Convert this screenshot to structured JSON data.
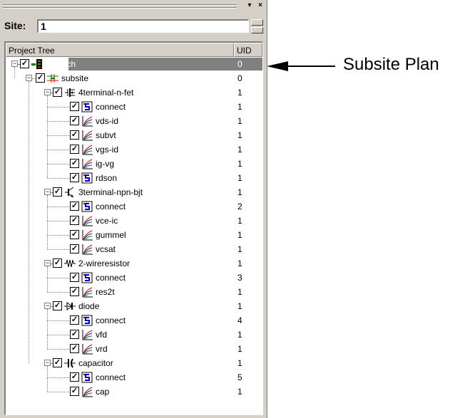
{
  "window": {
    "minimize_glyph": "▾",
    "close_glyph": "×"
  },
  "site": {
    "label": "Site:",
    "value": "1"
  },
  "tree": {
    "col_project": "Project Tree",
    "col_uid": "UID",
    "rows": [
      {
        "label": "ivswitch",
        "uid": "0",
        "icon": "plan-icon",
        "level": 0,
        "expander": "minus",
        "selected": true
      },
      {
        "label": "subsite",
        "uid": "0",
        "icon": "subsite-icon",
        "level": 1,
        "expander": "minus"
      },
      {
        "label": "4terminal-n-fet",
        "uid": "1",
        "icon": "nfet-icon",
        "level": 2,
        "expander": "minus"
      },
      {
        "label": "connect",
        "uid": "1",
        "icon": "connect-icon",
        "level": 3
      },
      {
        "label": "vds-id",
        "uid": "1",
        "icon": "curve-icon",
        "level": 3
      },
      {
        "label": "subvt",
        "uid": "1",
        "icon": "curve-icon",
        "level": 3
      },
      {
        "label": "vgs-id",
        "uid": "1",
        "icon": "curve-icon",
        "level": 3
      },
      {
        "label": "ig-vg",
        "uid": "1",
        "icon": "curve-icon",
        "level": 3
      },
      {
        "label": "rdson",
        "uid": "1",
        "icon": "connect-icon",
        "level": 3
      },
      {
        "label": "3terminal-npn-bjt",
        "uid": "1",
        "icon": "bjt-icon",
        "level": 2,
        "expander": "minus"
      },
      {
        "label": "connect",
        "uid": "2",
        "icon": "connect-icon",
        "level": 3
      },
      {
        "label": "vce-ic",
        "uid": "1",
        "icon": "curve-icon",
        "level": 3
      },
      {
        "label": "gummel",
        "uid": "1",
        "icon": "curve-icon",
        "level": 3
      },
      {
        "label": "vcsat",
        "uid": "1",
        "icon": "curve-icon",
        "level": 3
      },
      {
        "label": "2-wireresistor",
        "uid": "1",
        "icon": "resistor-icon",
        "level": 2,
        "expander": "minus"
      },
      {
        "label": "connect",
        "uid": "3",
        "icon": "connect-icon",
        "level": 3
      },
      {
        "label": "res2t",
        "uid": "1",
        "icon": "curve-icon",
        "level": 3
      },
      {
        "label": "diode",
        "uid": "1",
        "icon": "diode-icon",
        "level": 2,
        "expander": "minus"
      },
      {
        "label": "connect",
        "uid": "4",
        "icon": "connect-icon",
        "level": 3
      },
      {
        "label": "vfd",
        "uid": "1",
        "icon": "curve-icon",
        "level": 3
      },
      {
        "label": "vrd",
        "uid": "1",
        "icon": "curve-icon",
        "level": 3
      },
      {
        "label": "capacitor",
        "uid": "1",
        "icon": "capacitor-icon",
        "level": 2,
        "expander": "minus"
      },
      {
        "label": "connect",
        "uid": "5",
        "icon": "connect-icon",
        "level": 3
      },
      {
        "label": "cap",
        "uid": "1",
        "icon": "curve-icon",
        "level": 3
      }
    ]
  },
  "annotation": {
    "label": "Subsite Plan"
  },
  "colors": {
    "panel": "#d4d0c8",
    "selection": "#808080"
  }
}
